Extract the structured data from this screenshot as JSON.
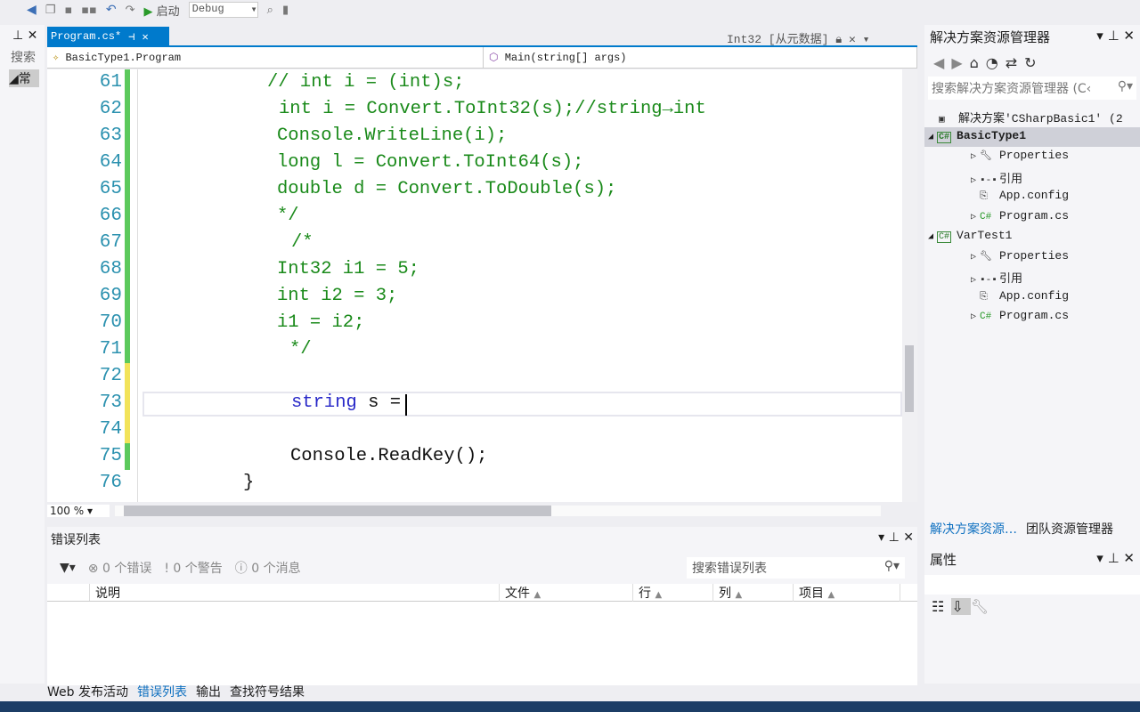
{
  "toolbar": {
    "start_label": "启动",
    "config": "Debug"
  },
  "editor_tab": {
    "label": "Program.cs*",
    "metadata_tab": "Int32 [从元数据]"
  },
  "left_panel": {
    "search_label": "搜索",
    "group_label": "常"
  },
  "nav": {
    "class": "BasicType1.Program",
    "member": "Main(string[] args)"
  },
  "code": [
    {
      "n": "61",
      "parts": [
        {
          "t": "// int i = (int)s;",
          "c": "cm"
        }
      ],
      "change": "saved"
    },
    {
      "n": "62",
      "parts": [
        {
          "t": "int i = Convert.ToInt32(s);//string→int",
          "c": "cm"
        }
      ],
      "change": "saved"
    },
    {
      "n": "63",
      "parts": [
        {
          "t": "Console.WriteLine(i);",
          "c": "cm"
        }
      ],
      "change": "saved"
    },
    {
      "n": "64",
      "parts": [
        {
          "t": "long l = Convert.ToInt64(s);",
          "c": "cm"
        }
      ],
      "change": "saved"
    },
    {
      "n": "65",
      "parts": [
        {
          "t": "double d = Convert.ToDouble(s);",
          "c": "cm"
        }
      ],
      "change": "saved"
    },
    {
      "n": "66",
      "parts": [
        {
          "t": "*/",
          "c": "cm"
        }
      ],
      "change": "saved"
    },
    {
      "n": "67",
      "parts": [
        {
          "t": "/*",
          "c": "cm"
        }
      ],
      "change": "saved"
    },
    {
      "n": "68",
      "parts": [
        {
          "t": "Int32 i1 = 5;",
          "c": "cm"
        }
      ],
      "change": "saved"
    },
    {
      "n": "69",
      "parts": [
        {
          "t": "int i2 = 3;",
          "c": "cm"
        }
      ],
      "change": "saved"
    },
    {
      "n": "70",
      "parts": [
        {
          "t": "i1 = i2;",
          "c": "cm"
        }
      ],
      "change": "saved"
    },
    {
      "n": "71",
      "parts": [
        {
          "t": "*/",
          "c": "cm"
        }
      ],
      "change": "saved"
    },
    {
      "n": "72",
      "parts": [],
      "change": "unsaved"
    },
    {
      "n": "73",
      "parts": [
        {
          "t": "string",
          "c": "kw"
        },
        {
          "t": " s =",
          "c": "tx"
        }
      ],
      "change": "unsaved"
    },
    {
      "n": "74",
      "parts": [],
      "change": "unsaved"
    },
    {
      "n": "75",
      "parts": [
        {
          "t": "Console.ReadKey();",
          "c": "tx"
        }
      ],
      "change": "saved"
    },
    {
      "n": "76",
      "parts": [
        {
          "t": "}",
          "c": "tx"
        }
      ],
      "change": "none"
    }
  ],
  "colors": {
    "saved": "#5cc95c",
    "unsaved": "#f2e35a",
    "accent": "#007acc"
  },
  "zoom": "100 %",
  "error_list": {
    "title": "错误列表",
    "errors": "0 个错误",
    "warnings": "0 个警告",
    "messages": "0 个消息",
    "search_placeholder": "搜索错误列表",
    "columns": [
      "说明",
      "文件",
      "行",
      "列",
      "项目"
    ]
  },
  "bottom_tabs": [
    "Web 发布活动",
    "错误列表",
    "输出",
    "查找符号结果"
  ],
  "solution_explorer": {
    "title": "解决方案资源管理器",
    "search_placeholder": "搜索解决方案资源管理器 (C‹",
    "items": [
      {
        "label": "解决方案'CSharpBasic1' (2",
        "level": 0,
        "icon": "solution-icon",
        "arrow": ""
      },
      {
        "label": "BasicType1",
        "level": 1,
        "icon": "csharp-project-icon",
        "arrow": "◢",
        "selected": true
      },
      {
        "label": "Properties",
        "level": 2,
        "icon": "wrench-icon",
        "arrow": "▷"
      },
      {
        "label": "引用",
        "level": 2,
        "icon": "references-icon",
        "arrow": "▷"
      },
      {
        "label": "App.config",
        "level": 2,
        "icon": "config-icon",
        "arrow": ""
      },
      {
        "label": "Program.cs",
        "level": 2,
        "icon": "csharp-file-icon",
        "arrow": "▷"
      },
      {
        "label": "VarTest1",
        "level": 1,
        "icon": "csharp-project-icon",
        "arrow": "◢"
      },
      {
        "label": "Properties",
        "level": 2,
        "icon": "wrench-icon",
        "arrow": "▷"
      },
      {
        "label": "引用",
        "level": 2,
        "icon": "references-icon",
        "arrow": "▷"
      },
      {
        "label": "App.config",
        "level": 2,
        "icon": "config-icon",
        "arrow": ""
      },
      {
        "label": "Program.cs",
        "level": 2,
        "icon": "csharp-file-icon",
        "arrow": "▷"
      }
    ],
    "tabs": [
      "解决方案资源…",
      "团队资源管理器"
    ]
  },
  "properties": {
    "title": "属性"
  }
}
